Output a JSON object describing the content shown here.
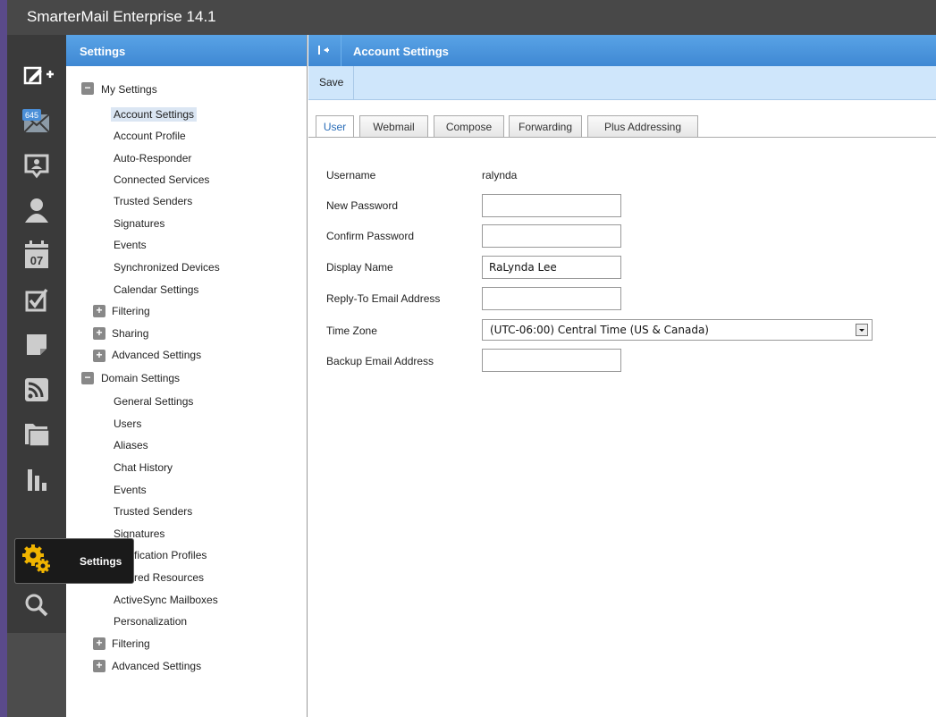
{
  "app": {
    "title": "SmarterMail Enterprise 14.1"
  },
  "iconbar": {
    "mail_badge": "645",
    "calendar_day": "07",
    "hover_label": "Settings",
    "items": [
      {
        "icon": "compose-icon"
      },
      {
        "icon": "mail-icon"
      },
      {
        "icon": "chat-icon"
      },
      {
        "icon": "contacts-icon"
      },
      {
        "icon": "calendar-icon"
      },
      {
        "icon": "tasks-icon"
      },
      {
        "icon": "notes-icon"
      },
      {
        "icon": "rss-icon"
      },
      {
        "icon": "files-icon"
      },
      {
        "icon": "reports-icon"
      },
      {
        "icon": "settings-icon"
      },
      {
        "icon": "search-icon"
      }
    ]
  },
  "tree": {
    "header": "Settings",
    "my_settings": {
      "label": "My Settings",
      "toggle": "−",
      "items": [
        "Account Settings",
        "Account Profile",
        "Auto-Responder",
        "Connected Services",
        "Trusted Senders",
        "Signatures",
        "Events",
        "Synchronized Devices",
        "Calendar Settings"
      ],
      "groups": [
        "Filtering",
        "Sharing",
        "Advanced Settings"
      ]
    },
    "domain_settings": {
      "label": "Domain Settings",
      "toggle": "−",
      "items": [
        "General Settings",
        "Users",
        "Aliases",
        "Chat History",
        "Events",
        "Trusted Senders",
        "Signatures",
        "fication Profiles",
        "red Resources",
        "ActiveSync Mailboxes",
        "Personalization"
      ],
      "groups": [
        "Filtering",
        "Advanced Settings"
      ]
    },
    "expand_glyph": "+"
  },
  "main": {
    "header": "Account Settings",
    "save_label": "Save",
    "tabs": [
      "User",
      "Webmail",
      "Compose",
      "Forwarding",
      "Plus Addressing"
    ],
    "form": {
      "username_label": "Username",
      "username_value": "ralynda",
      "new_password_label": "New Password",
      "new_password_value": "",
      "confirm_password_label": "Confirm Password",
      "confirm_password_value": "",
      "display_name_label": "Display Name",
      "display_name_value": "RaLynda Lee",
      "reply_to_label": "Reply-To Email Address",
      "reply_to_value": "",
      "time_zone_label": "Time Zone",
      "time_zone_value": "(UTC-06:00) Central Time (US & Canada)",
      "backup_email_label": "Backup Email Address",
      "backup_email_value": ""
    }
  },
  "colors": {
    "header_blue": "#4a94dc",
    "toolbar_blue": "#cfe6fb",
    "iconbar": "#3a3a3a",
    "settings_icon": "#f0b400"
  }
}
